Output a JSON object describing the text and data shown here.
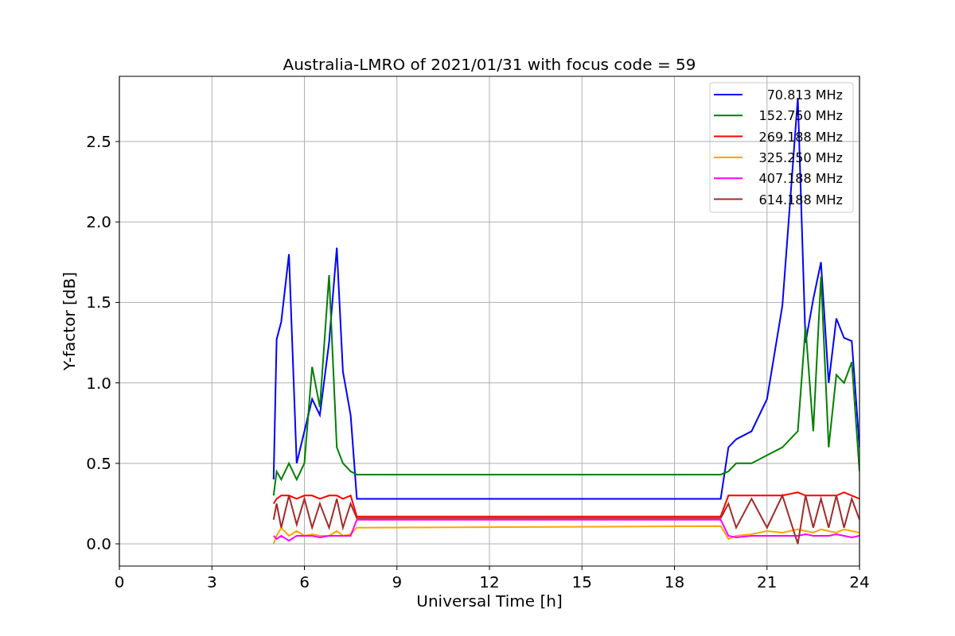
{
  "figure": {
    "chart_data": {
      "type": "line",
      "title": "Australia-LMRO of 2021/01/31 with focus code = 59",
      "xlabel": "Universal Time [h]",
      "ylabel": "Y-factor [dB]",
      "x": [
        5,
        5.1,
        5.25,
        5.5,
        5.75,
        6,
        6.25,
        6.5,
        6.8,
        7.05,
        7.25,
        7.5,
        7.7,
        19.5,
        19.75,
        20,
        20.5,
        21,
        21.5,
        22,
        22.25,
        22.5,
        22.75,
        23,
        23.25,
        23.5,
        23.75,
        24
      ],
      "grid": true,
      "legend": true,
      "xlim": [
        0,
        24
      ],
      "ylim": [
        -0.138,
        2.905
      ],
      "xticks": [
        0,
        3,
        6,
        9,
        12,
        15,
        18,
        21,
        24
      ],
      "yticks": [
        {
          "value": 0,
          "label": "0.0"
        },
        {
          "value": 0.5,
          "label": "0.5"
        },
        {
          "value": 1,
          "label": "1.0"
        },
        {
          "value": 1.5,
          "label": "1.5"
        },
        {
          "value": 2,
          "label": "2.0"
        },
        {
          "value": 2.5,
          "label": "2.5"
        }
      ],
      "series": [
        {
          "name": "70.813 MHz",
          "color": "#0000ff",
          "values": [
            0.4,
            1.27,
            1.38,
            1.8,
            0.5,
            0.7,
            0.9,
            0.8,
            1.25,
            1.84,
            1.07,
            0.8,
            0.28,
            0.28,
            0.6,
            0.65,
            0.7,
            0.9,
            1.48,
            2.77,
            1.25,
            1.52,
            1.75,
            1.0,
            1.4,
            1.28,
            1.26,
            0.6
          ]
        },
        {
          "name": "152.750 MHz",
          "color": "#008000",
          "values": [
            0.3,
            0.45,
            0.4,
            0.5,
            0.4,
            0.5,
            1.1,
            0.85,
            1.67,
            0.6,
            0.5,
            0.45,
            0.43,
            0.43,
            0.45,
            0.5,
            0.5,
            0.55,
            0.6,
            0.7,
            1.35,
            0.7,
            1.66,
            0.6,
            1.05,
            1.0,
            1.13,
            0.45
          ]
        },
        {
          "name": "269.188 MHz",
          "color": "#ff0000",
          "values": [
            0.25,
            0.28,
            0.3,
            0.3,
            0.28,
            0.3,
            0.3,
            0.28,
            0.3,
            0.3,
            0.28,
            0.3,
            0.17,
            0.17,
            0.3,
            0.3,
            0.3,
            0.3,
            0.3,
            0.32,
            0.3,
            0.3,
            0.3,
            0.3,
            0.3,
            0.32,
            0.3,
            0.28
          ]
        },
        {
          "name": "325.250 MHz",
          "color": "#ffa500",
          "values": [
            0.0,
            0.05,
            0.1,
            0.05,
            0.08,
            0.05,
            0.06,
            0.05,
            0.05,
            0.08,
            0.05,
            0.06,
            0.1,
            0.11,
            0.03,
            0.05,
            0.06,
            0.08,
            0.07,
            0.09,
            0.08,
            0.07,
            0.09,
            0.08,
            0.07,
            0.09,
            0.08,
            0.07
          ]
        },
        {
          "name": "407.188 MHz",
          "color": "#ff00ff",
          "values": [
            0.05,
            0.03,
            0.05,
            0.02,
            0.05,
            0.05,
            0.05,
            0.04,
            0.05,
            0.05,
            0.05,
            0.05,
            0.15,
            0.15,
            0.05,
            0.04,
            0.05,
            0.05,
            0.05,
            0.05,
            0.06,
            0.05,
            0.05,
            0.05,
            0.06,
            0.05,
            0.04,
            0.05
          ]
        },
        {
          "name": "614.188 MHz",
          "color": "#a52a2a",
          "values": [
            0.15,
            0.25,
            0.1,
            0.3,
            0.12,
            0.28,
            0.1,
            0.25,
            0.1,
            0.28,
            0.1,
            0.25,
            0.16,
            0.16,
            0.25,
            0.1,
            0.28,
            0.1,
            0.3,
            0.0,
            0.3,
            0.1,
            0.28,
            0.1,
            0.3,
            0.1,
            0.28,
            0.15
          ]
        }
      ]
    }
  }
}
